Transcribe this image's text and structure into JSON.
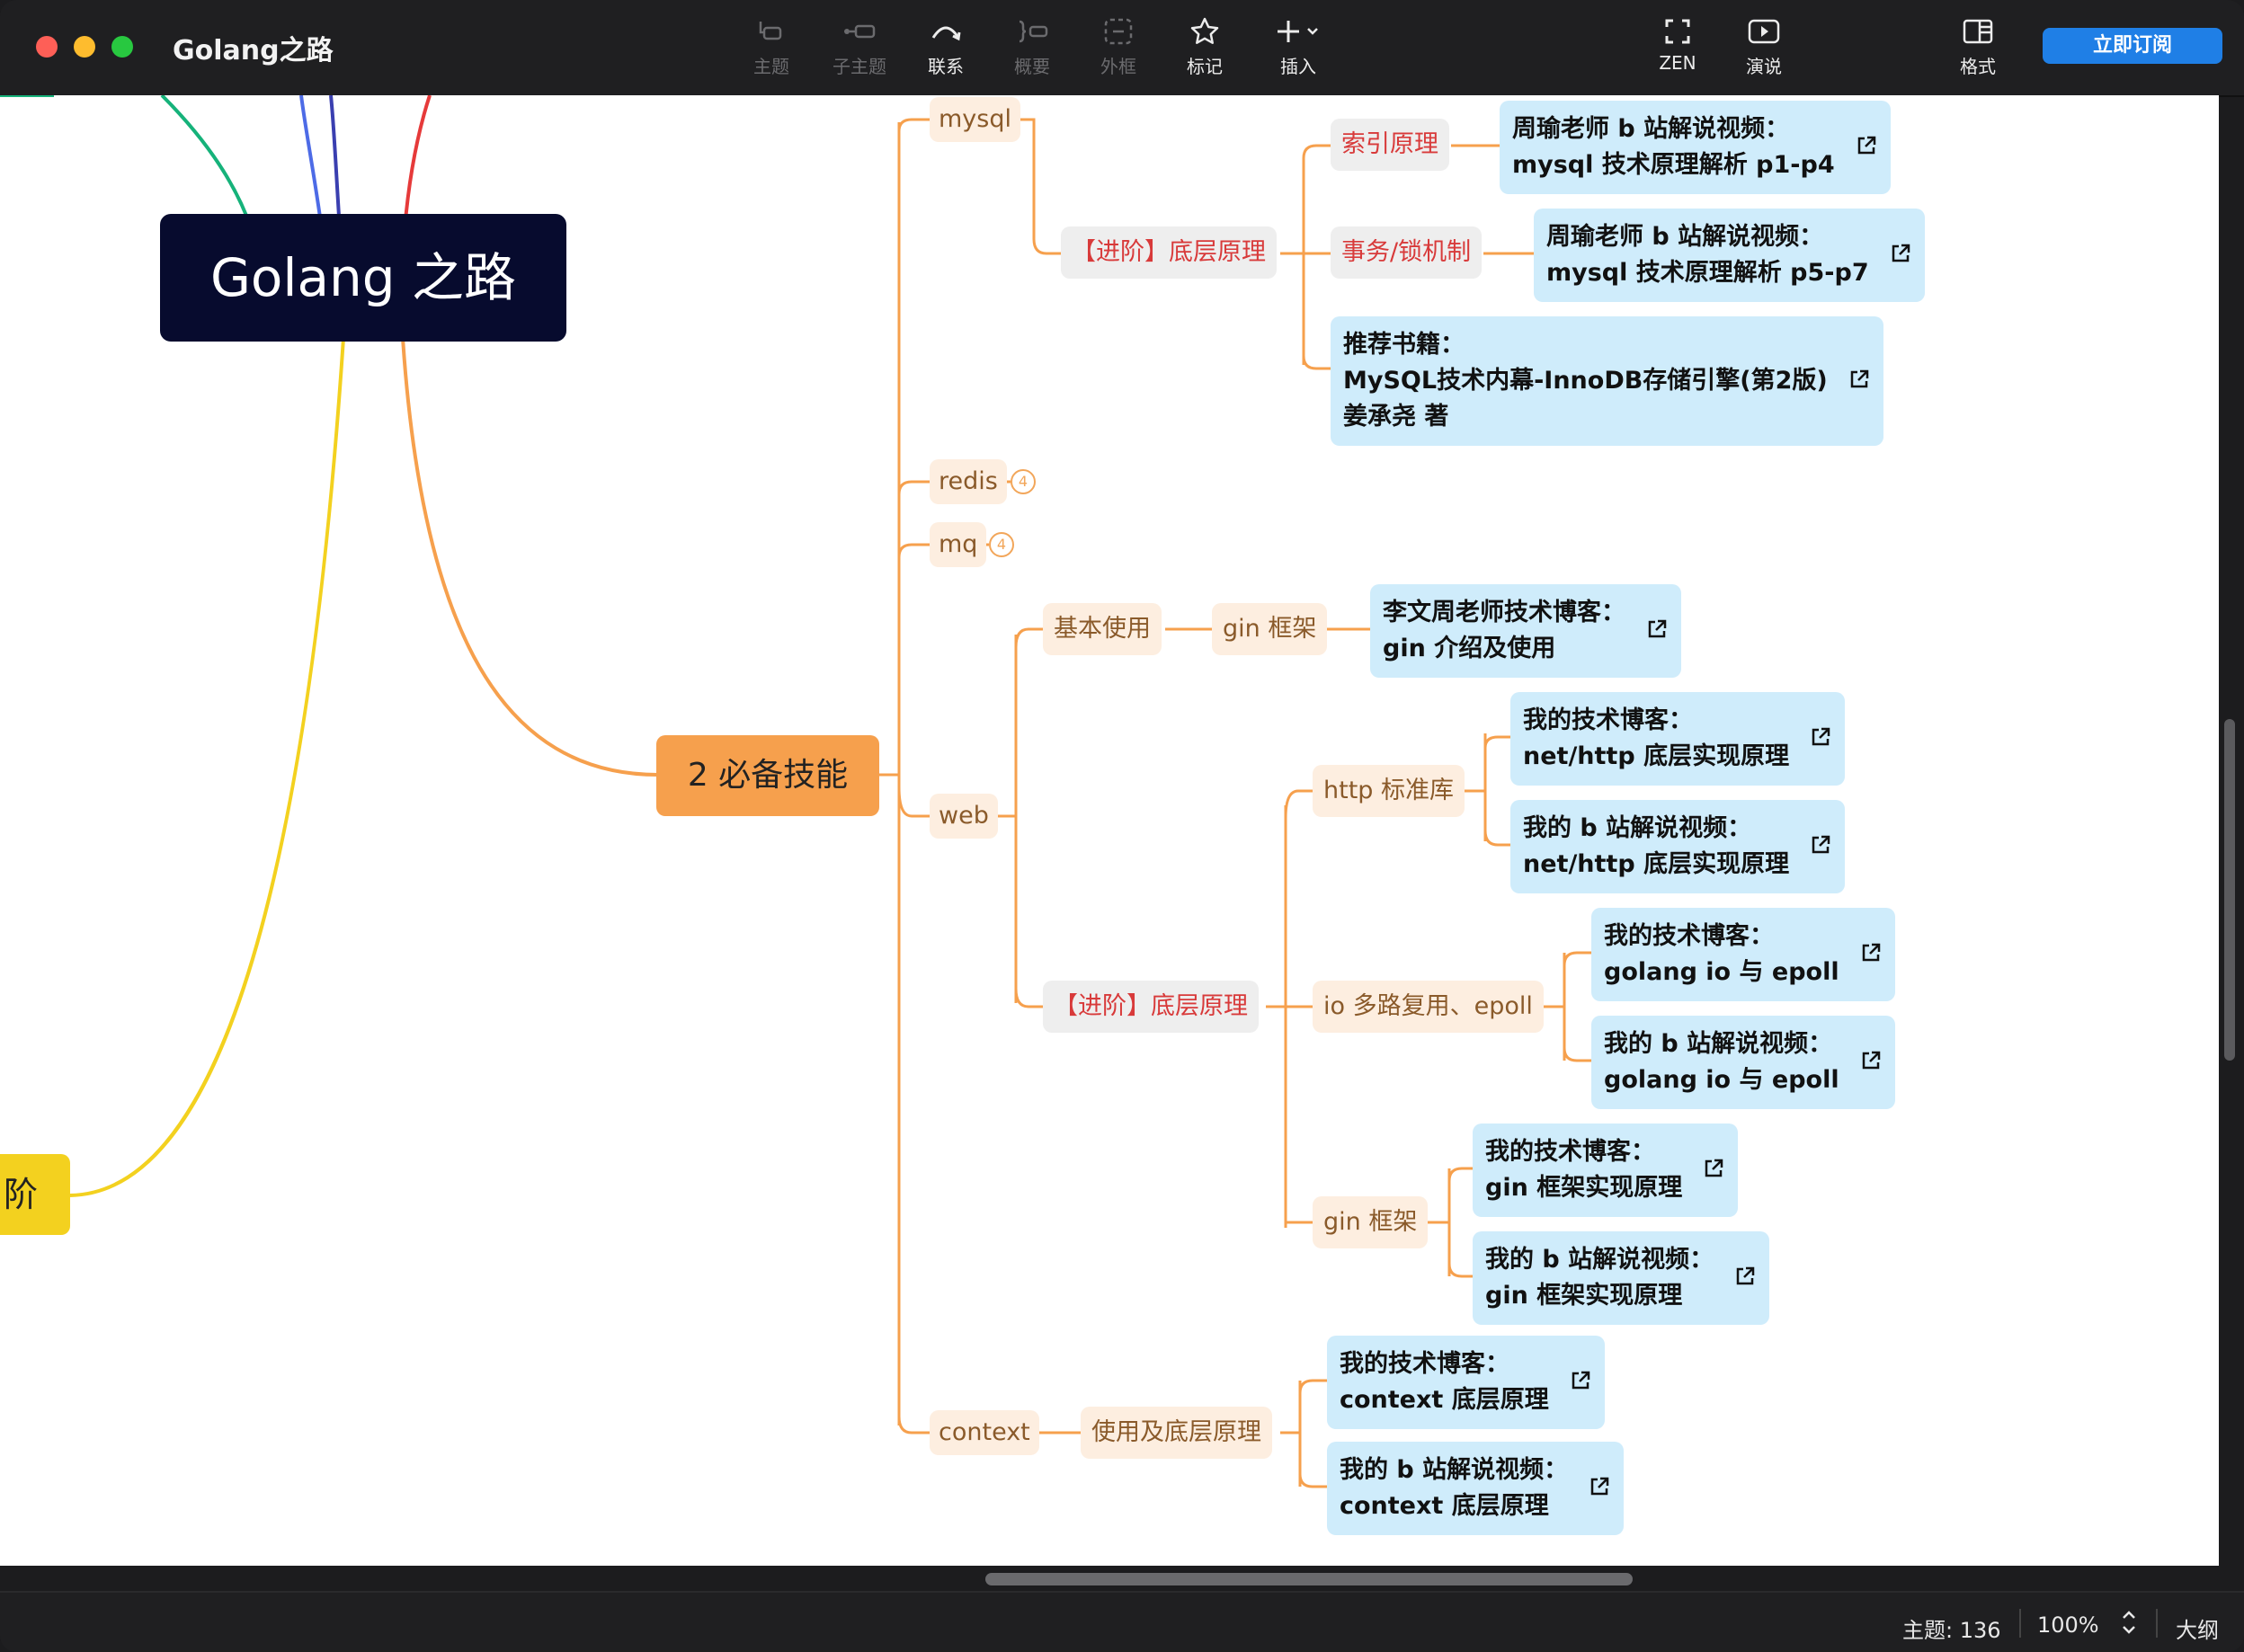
{
  "app": {
    "title": "Golang之路"
  },
  "toolbar": {
    "items": [
      {
        "label": "主题"
      },
      {
        "label": "子主题"
      },
      {
        "label": "联系"
      },
      {
        "label": "概要"
      },
      {
        "label": "外框"
      },
      {
        "label": "标记"
      },
      {
        "label": "插入"
      },
      {
        "label": "ZEN"
      },
      {
        "label": "演说"
      },
      {
        "label": "格式"
      }
    ],
    "subscribe_label": "立即订阅"
  },
  "map": {
    "root": "Golang 之路",
    "yellow_branch_fragment": "阶",
    "branch": "2 必备技能",
    "mysql": {
      "label": "mysql",
      "advanced": "【进阶】底层原理",
      "index": "索引原理",
      "index_leaf": [
        "周瑜老师 b 站解说视频：",
        "mysql 技术原理解析 p1-p4"
      ],
      "txn": "事务/锁机制",
      "txn_leaf": [
        "周瑜老师 b 站解说视频：",
        "mysql 技术原理解析 p5-p7"
      ],
      "book_leaf": [
        "推荐书籍：",
        "MySQL技术内幕-InnoDB存储引擎(第2版)",
        "姜承尧 著"
      ]
    },
    "redis": {
      "label": "redis",
      "count": "4"
    },
    "mq": {
      "label": "mq",
      "count": "4"
    },
    "web": {
      "label": "web",
      "basic": "基本使用",
      "gin_basic": "gin 框架",
      "gin_basic_leaf": [
        "李文周老师技术博客：",
        "gin 介绍及使用"
      ],
      "advanced": "【进阶】底层原理",
      "http": "http 标准库",
      "http_leaf1": [
        "我的技术博客：",
        "net/http 底层实现原理"
      ],
      "http_leaf2": [
        "我的 b 站解说视频：",
        "net/http 底层实现原理"
      ],
      "io": "io 多路复用、epoll",
      "io_leaf1": [
        "我的技术博客：",
        "golang io 与 epoll"
      ],
      "io_leaf2": [
        "我的 b 站解说视频：",
        "golang io 与 epoll"
      ],
      "gin_adv": "gin 框架",
      "gin_leaf1": [
        "我的技术博客：",
        "gin 框架实现原理"
      ],
      "gin_leaf2": [
        "我的 b 站解说视频：",
        "gin 框架实现原理"
      ]
    },
    "context": {
      "label": "context",
      "usage": "使用及底层原理",
      "leaf1": [
        "我的技术博客：",
        "context 底层原理"
      ],
      "leaf2": [
        "我的 b 站解说视频：",
        "context 底层原理"
      ]
    }
  },
  "status": {
    "topics": "主题: 136",
    "zoom": "100%",
    "outline": "大纲"
  },
  "colors": {
    "branch_orange": "#f6a04d",
    "root_bg": "#070b2e",
    "leaf_bg": "#cfecfb",
    "accent_blue": "#1f7fe6"
  }
}
